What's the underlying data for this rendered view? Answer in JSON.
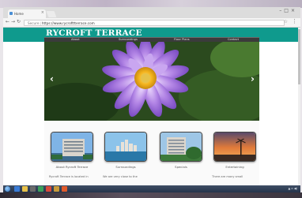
{
  "browser": {
    "tab_title": "Home",
    "address_secure_label": "Secure",
    "address_url": "https://www.rycrofttterrace.com"
  },
  "site": {
    "logo_text": "RYCROFT TERRACE",
    "nav": [
      "About",
      "Surroundings",
      "Floor Plans",
      "Contact"
    ],
    "slider_prev": "‹",
    "slider_next": "›",
    "cards": [
      {
        "caption": "About Rycroft Terrace",
        "text": "Rycroft Terrace is located in"
      },
      {
        "caption": "Surroundings",
        "text": "We are very close to the"
      },
      {
        "caption": "Specials",
        "text": ""
      },
      {
        "caption": "Entertaining",
        "text": "There are many small"
      }
    ]
  },
  "colors": {
    "banner": "#0f9a8d",
    "nav_bar": "#3b3b3b"
  },
  "icons": [
    "back-icon",
    "forward-icon",
    "reload-icon",
    "star-icon",
    "menu-icon",
    "windows-start-icon"
  ]
}
